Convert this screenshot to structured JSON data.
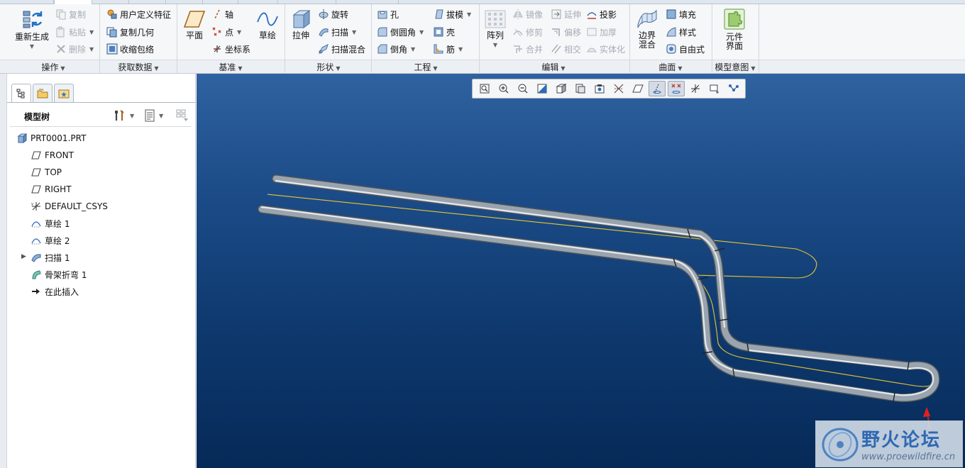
{
  "ribbon": {
    "operations": {
      "group_label": "操作",
      "regenerate": "重新生成",
      "copy": "复制",
      "paste": "粘贴",
      "delete": "删除"
    },
    "get_data": {
      "group_label": "获取数据",
      "udf": "用户定义特征",
      "copy_geometry": "复制几何",
      "shrinkwrap": "收缩包络"
    },
    "datum": {
      "group_label": "基准",
      "plane": "平面",
      "axis": "轴",
      "point": "点",
      "csys": "坐标系",
      "sketch": "草绘"
    },
    "shapes": {
      "group_label": "形状",
      "extrude": "拉伸",
      "revolve": "旋转",
      "sweep": "扫描",
      "swept_blend": "扫描混合"
    },
    "engineering": {
      "group_label": "工程",
      "hole": "孔",
      "round": "倒圆角",
      "chamfer": "倒角",
      "draft": "拔模",
      "shell": "壳",
      "rib": "筋"
    },
    "editing": {
      "group_label": "编辑",
      "pattern": "阵列",
      "mirror": "镜像",
      "trim": "修剪",
      "merge": "合并",
      "extend": "延伸",
      "offset": "偏移",
      "intersect": "相交",
      "project": "投影",
      "thicken": "加厚",
      "solidify": "实体化"
    },
    "surfaces": {
      "group_label": "曲面",
      "boundary_blend": "边界混合",
      "fill": "填充",
      "style": "样式",
      "freestyle": "自由式"
    },
    "model_intent": {
      "group_label": "模型意图",
      "component_interface": "元件界面"
    }
  },
  "model_tree": {
    "title": "模型树",
    "items": [
      {
        "label": "PRT0001.PRT",
        "icon": "part-icon"
      },
      {
        "label": "FRONT",
        "icon": "datum-plane-icon"
      },
      {
        "label": "TOP",
        "icon": "datum-plane-icon"
      },
      {
        "label": "RIGHT",
        "icon": "datum-plane-icon"
      },
      {
        "label": "DEFAULT_CSYS",
        "icon": "csys-icon"
      },
      {
        "label": "草绘 1",
        "icon": "sketch-icon"
      },
      {
        "label": "草绘 2",
        "icon": "sketch-icon"
      },
      {
        "label": "扫描 1",
        "icon": "sweep-icon"
      },
      {
        "label": "骨架折弯 1",
        "icon": "spinal-bend-icon"
      },
      {
        "label": "在此插入",
        "icon": "insert-here-arrow-icon"
      }
    ]
  },
  "watermark": {
    "name": "野火论坛",
    "url": "www.proewildfire.cn"
  },
  "colors": {
    "viewport_top": "#2f62a0",
    "viewport_bottom": "#062a58",
    "tube": "#9aa4ae",
    "trajectory": "#e8c630",
    "annotation_arrow": "#e02020"
  }
}
